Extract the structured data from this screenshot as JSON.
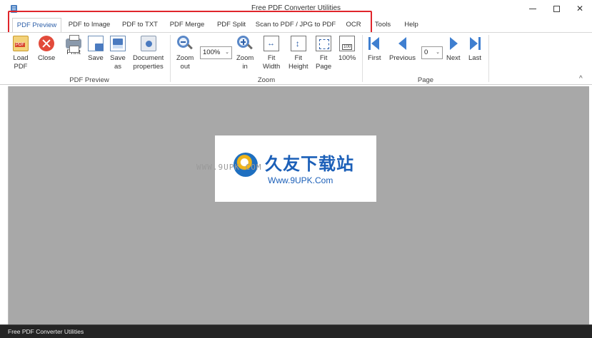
{
  "window": {
    "title": "Free PDF Converter Utilities",
    "icon": "app-icon",
    "controls": [
      "minimize",
      "maximize",
      "close"
    ]
  },
  "tabs": [
    {
      "label": "PDF Preview",
      "active": true
    },
    {
      "label": "PDF to Image",
      "active": false
    },
    {
      "label": "PDF to TXT",
      "active": false
    },
    {
      "label": "PDF Merge",
      "active": false
    },
    {
      "label": "PDF Split",
      "active": false
    },
    {
      "label": "Scan to PDF / JPG to PDF",
      "active": false
    },
    {
      "label": "OCR",
      "active": false
    },
    {
      "label": "Tools",
      "active": false
    },
    {
      "label": "Help",
      "active": false
    }
  ],
  "ribbon": {
    "groups": {
      "preview": "PDF Preview",
      "zoom": "Zoom",
      "page": "Page"
    },
    "buttons": {
      "load_pdf": {
        "line1": "Load",
        "line2": "PDF"
      },
      "close": {
        "line1": "Close"
      },
      "print": {
        "line1": "Print"
      },
      "save": {
        "line1": "Save"
      },
      "save_as": {
        "line1": "Save",
        "line2": "as"
      },
      "doc_props": {
        "line1": "Document",
        "line2": "properties"
      },
      "zoom_out": {
        "line1": "Zoom",
        "line2": "out"
      },
      "zoom_in": {
        "line1": "Zoom",
        "line2": "in"
      },
      "fit_width": {
        "line1": "Fit",
        "line2": "Width"
      },
      "fit_height": {
        "line1": "Fit",
        "line2": "Height"
      },
      "fit_page": {
        "line1": "Fit",
        "line2": "Page"
      },
      "zoom_100": {
        "line1": "100%"
      },
      "first": {
        "line1": "First"
      },
      "previous": {
        "line1": "Previous"
      },
      "next": {
        "line1": "Next"
      },
      "last": {
        "line1": "Last"
      }
    },
    "zoom_value": "100%",
    "page_value": "0",
    "collapse_glyph": "^"
  },
  "watermark": {
    "cn": "久友下载站",
    "url": "Www.9UPK.Com",
    "faint": "WWW.9UPK.COM"
  },
  "status": {
    "text": "Free PDF Converter Utilities"
  },
  "colors": {
    "highlight": "#e0252b",
    "accent": "#2d5fa8",
    "canvas": "#a8a8a8",
    "statusbar": "#252525"
  }
}
